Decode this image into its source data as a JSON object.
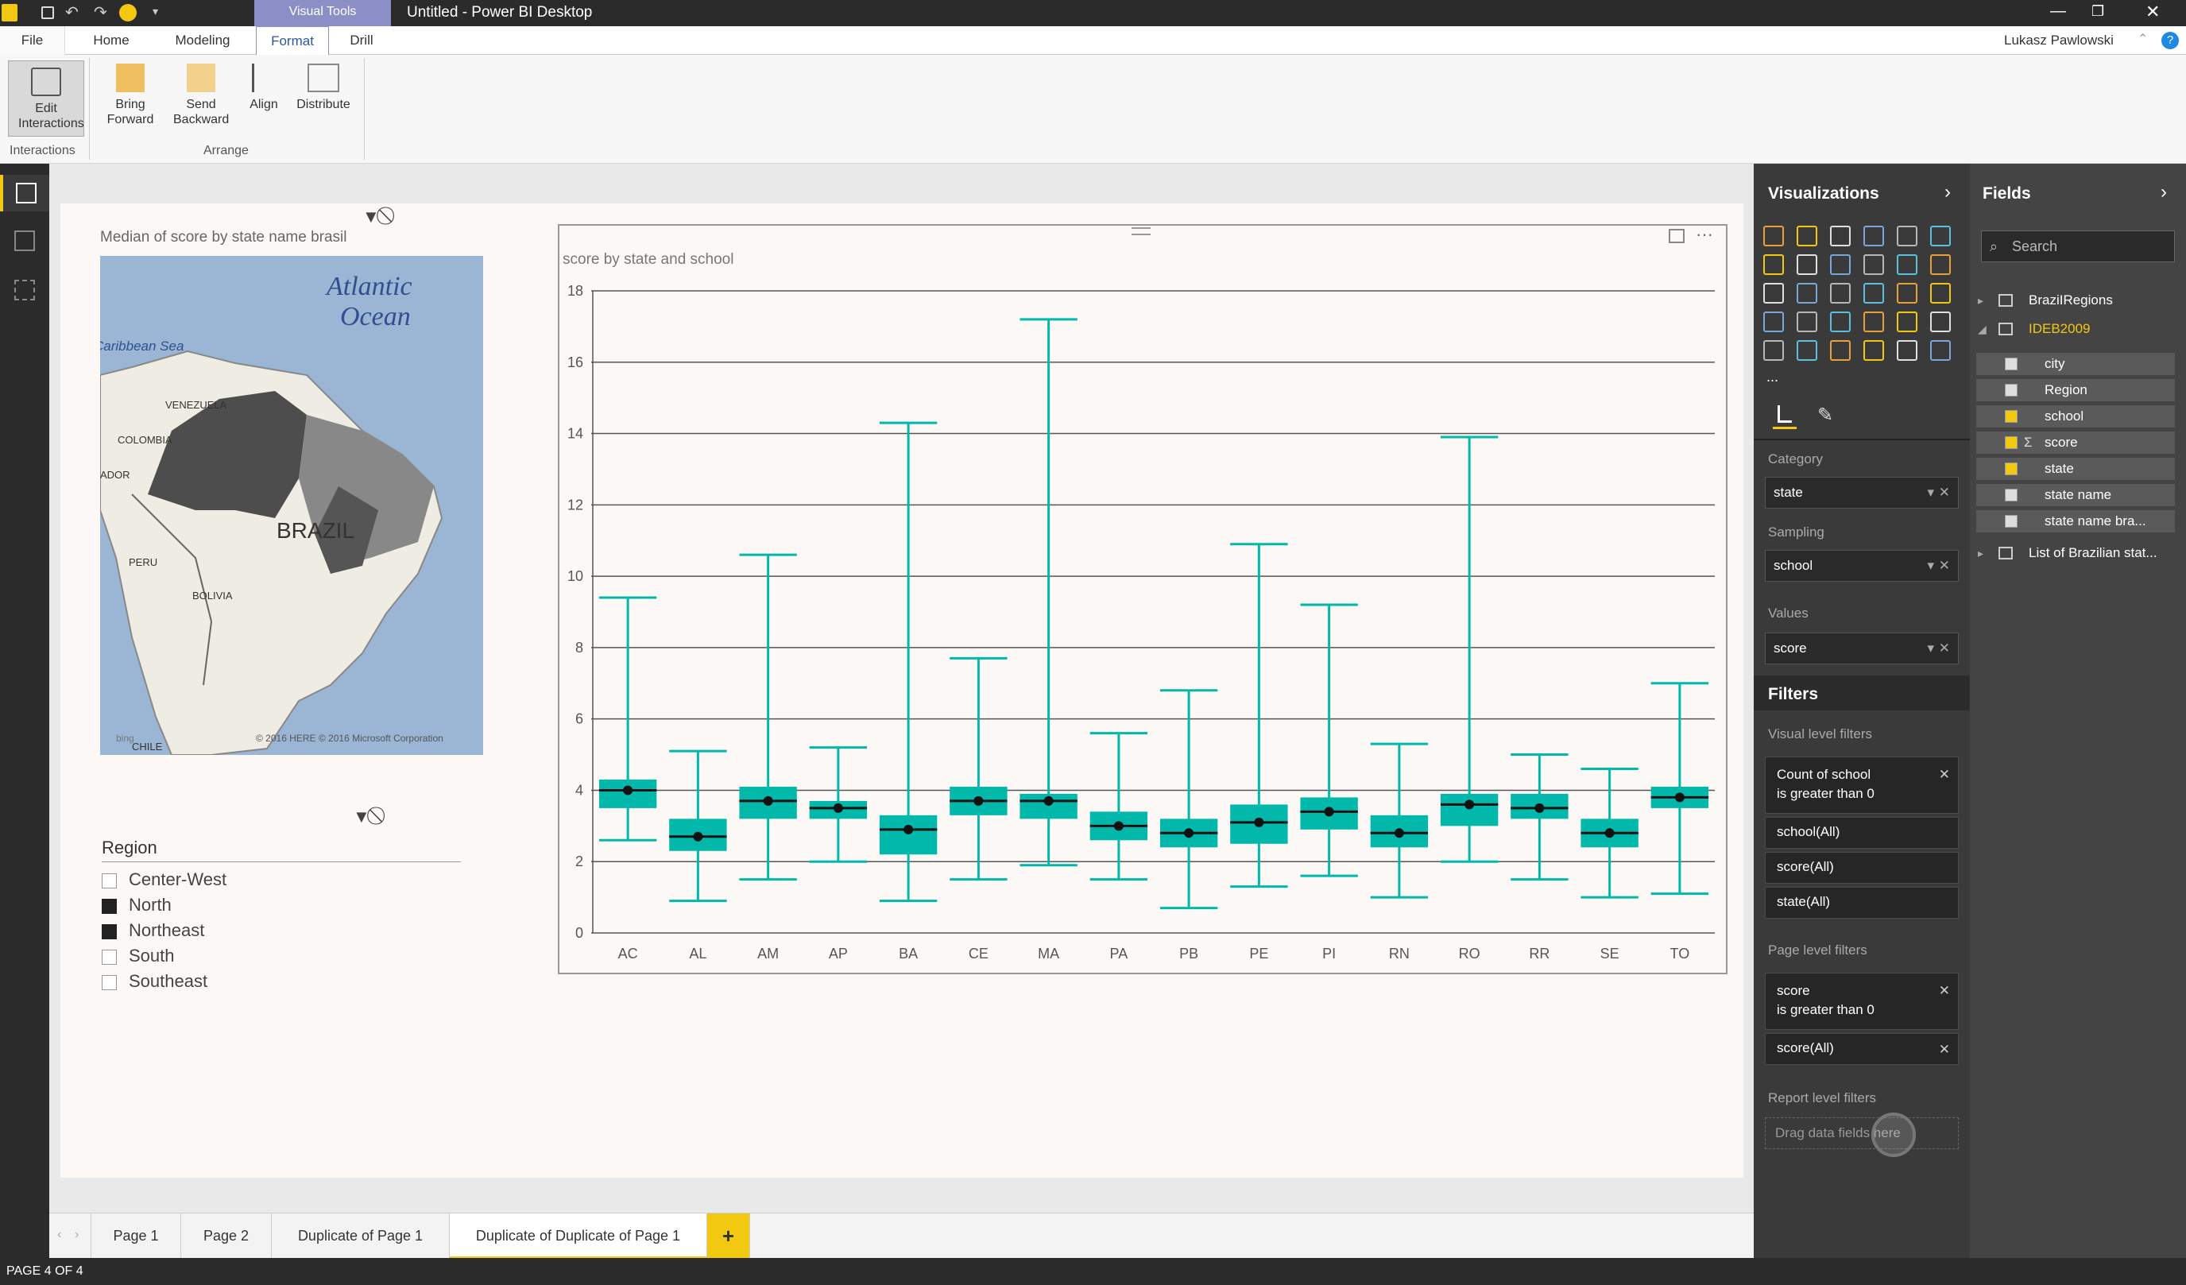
{
  "window": {
    "title": "Untitled - Power BI Desktop",
    "context_tab": "Visual Tools",
    "user": "Lukasz Pawlowski"
  },
  "ribbon": {
    "tabs": [
      "File",
      "Home",
      "Modeling",
      "Format",
      "Drill"
    ],
    "buttons": {
      "edit_interactions": "Edit Interactions",
      "bring_forward": "Bring Forward",
      "send_backward": "Send Backward",
      "align": "Align",
      "distribute": "Distribute"
    },
    "groups": {
      "interactions": "Interactions",
      "arrange": "Arrange"
    }
  },
  "map": {
    "title": "Median of score by state name brasil",
    "labels": {
      "ocean1": "Atlantic",
      "ocean2": "Ocean",
      "sea": "Caribbean Sea",
      "venezuela": "VENEZUELA",
      "colombia": "COLOMBIA",
      "ecuador": "ADOR",
      "peru": "PERU",
      "brazil": "BRAZIL",
      "bolivia": "BOLIVIA",
      "chile": "CHILE"
    },
    "copyright": "© 2016 HERE   © 2016 Microsoft Corporation",
    "bing": "bing"
  },
  "slicer": {
    "title": "Region",
    "items": [
      {
        "label": "Center-West",
        "checked": false
      },
      {
        "label": "North",
        "checked": true
      },
      {
        "label": "Northeast",
        "checked": true
      },
      {
        "label": "South",
        "checked": false
      },
      {
        "label": "Southeast",
        "checked": false
      }
    ]
  },
  "chart_data": {
    "type": "boxplot",
    "title": "score by state and school",
    "xlabel": "",
    "ylabel": "",
    "ylim": [
      0,
      18
    ],
    "yticks": [
      0,
      2,
      4,
      6,
      8,
      10,
      12,
      14,
      16,
      18
    ],
    "color": "#01b8aa",
    "categories": [
      "AC",
      "AL",
      "AM",
      "AP",
      "BA",
      "CE",
      "MA",
      "PA",
      "PB",
      "PE",
      "PI",
      "RN",
      "RO",
      "RR",
      "SE",
      "TO"
    ],
    "min": [
      2.6,
      0.9,
      1.5,
      2.0,
      0.9,
      1.5,
      1.9,
      1.5,
      0.7,
      1.3,
      1.6,
      1.0,
      2.0,
      1.5,
      1.0,
      1.1
    ],
    "q1": [
      3.5,
      2.3,
      3.2,
      3.2,
      2.2,
      3.3,
      3.2,
      2.6,
      2.4,
      2.5,
      2.9,
      2.4,
      3.0,
      3.2,
      2.4,
      3.5
    ],
    "median": [
      4.0,
      2.7,
      3.7,
      3.5,
      2.9,
      3.7,
      3.7,
      3.0,
      2.8,
      3.1,
      3.4,
      2.8,
      3.6,
      3.5,
      2.8,
      3.8
    ],
    "q3": [
      4.3,
      3.2,
      4.1,
      3.7,
      3.3,
      4.1,
      3.9,
      3.4,
      3.2,
      3.6,
      3.8,
      3.3,
      3.9,
      3.9,
      3.2,
      4.1
    ],
    "max": [
      9.4,
      5.1,
      10.6,
      5.2,
      14.3,
      7.7,
      17.2,
      5.6,
      6.8,
      10.9,
      9.2,
      5.3,
      13.9,
      5.0,
      4.6,
      7.0
    ],
    "mean": [
      4.0,
      2.7,
      3.7,
      3.5,
      2.9,
      3.7,
      3.7,
      3.0,
      2.8,
      3.1,
      3.4,
      2.8,
      3.6,
      3.5,
      2.8,
      3.8
    ]
  },
  "viz_pane": {
    "title": "Visualizations",
    "wells": [
      {
        "label": "Category",
        "value": "state"
      },
      {
        "label": "Sampling",
        "value": "school"
      },
      {
        "label": "Values",
        "value": "score"
      }
    ],
    "more": "...",
    "filters_title": "Filters",
    "visual_level_label": "Visual level filters",
    "visual_filters": [
      {
        "line1": "Count of school",
        "line2": "is greater than 0"
      },
      {
        "line1": "school(All)"
      },
      {
        "line1": "score(All)"
      },
      {
        "line1": "state(All)"
      }
    ],
    "page_level_label": "Page level filters",
    "page_filters": [
      {
        "line1": "score",
        "line2": "is greater than 0"
      },
      {
        "line1": "score(All)"
      }
    ],
    "report_level_label": "Report level filters",
    "drop_hint": "Drag data fields here"
  },
  "fields_pane": {
    "title": "Fields",
    "search_placeholder": "Search",
    "tables": [
      "BraziIRegions",
      "IDEB2009",
      "List of Brazilian stat..."
    ],
    "fields": [
      {
        "name": "city",
        "checked": false
      },
      {
        "name": "Region",
        "checked": false
      },
      {
        "name": "school",
        "checked": true
      },
      {
        "name": "score",
        "checked": true,
        "sigma": "Σ"
      },
      {
        "name": "state",
        "checked": true
      },
      {
        "name": "state name",
        "checked": false
      },
      {
        "name": "state name bra...",
        "checked": false
      }
    ]
  },
  "pages": {
    "tabs": [
      "Page 1",
      "Page 2",
      "Duplicate of Page 1",
      "Duplicate of Duplicate of Page 1"
    ],
    "active": "Duplicate of Duplicate of Page 1",
    "add": "+"
  },
  "status": "PAGE 4 OF 4"
}
